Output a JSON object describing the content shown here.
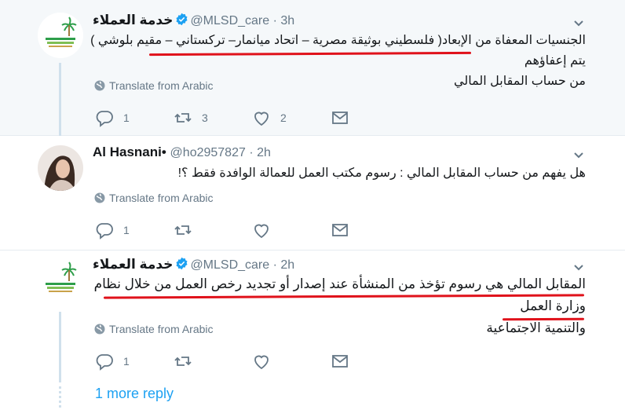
{
  "tweets": [
    {
      "name": "خدمة العملاء",
      "handle": "@MLSD_care",
      "time": "3h",
      "verified": true,
      "text_line1": "الجنسيات المعفاة من الإبعاد( فلسطيني بوثيقة مصرية – اتحاد ميانمار– تركستاني – مقيم بلوشي ) يتم إعفاؤهم",
      "text_line2": "من حساب المقابل المالي",
      "translate": "Translate from Arabic",
      "replies": "1",
      "retweets": "3",
      "likes": "2"
    },
    {
      "name": "Al Hasnani•",
      "handle": "@ho2957827",
      "time": "2h",
      "verified": false,
      "text_line1": "هل يفهم من حساب المقابل المالي : رسوم مكتب العمل للعمالة الوافدة فقط ؟!",
      "translate": "Translate from Arabic",
      "replies": "1",
      "retweets": "",
      "likes": ""
    },
    {
      "name": "خدمة العملاء",
      "handle": "@MLSD_care",
      "time": "2h",
      "verified": true,
      "text_line1": "المقابل المالي هي رسوم تؤخذ من المنشأة عند إصدار أو تجديد رخص العمل من خلال نظام وزارة العمل",
      "text_line2": "والتنمية الاجتماعية",
      "translate": "Translate from Arabic",
      "replies": "1",
      "retweets": "",
      "likes": ""
    }
  ],
  "more_reply": "1 more reply",
  "colors": {
    "accent": "#1da1f2",
    "muted": "#657786",
    "highlight_bg": "#f5f8fa",
    "annotation_red": "#e0121b"
  }
}
